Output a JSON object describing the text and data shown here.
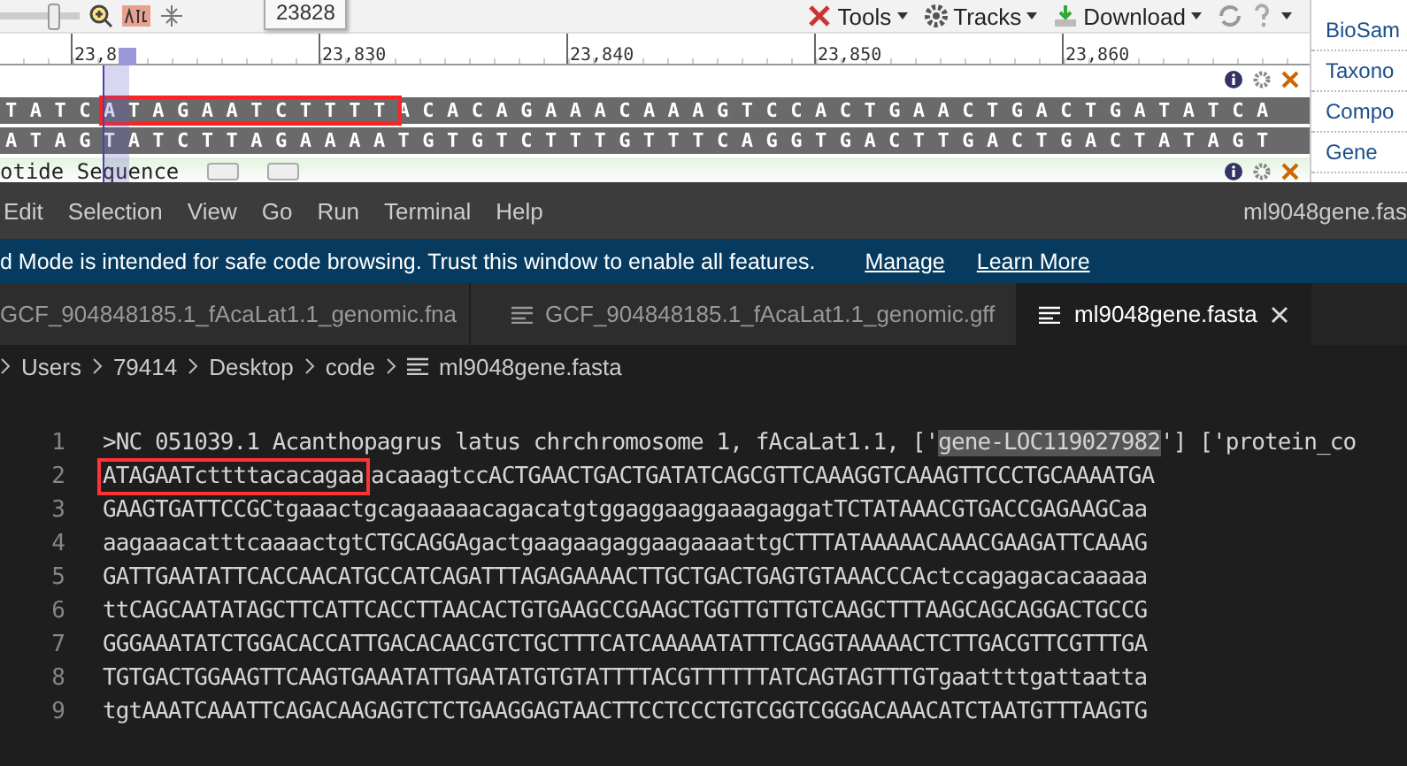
{
  "genome_browser": {
    "toolbar": {
      "tooltip": "23828",
      "zoom_slider": {
        "level": 0.7
      },
      "menus": [
        {
          "label": "Tools"
        },
        {
          "label": "Tracks"
        },
        {
          "label": "Download"
        }
      ]
    },
    "ruler": {
      "labels": [
        "23,8",
        "23,830",
        "23,840",
        "23,850",
        "23,860"
      ]
    },
    "forward_strand": [
      {
        "text": "TATC",
        "kind": "plain"
      },
      {
        "text": "ATAGAATCTTTT",
        "kind": "boxed"
      },
      {
        "text": "ACACAGAAACAAAGTCCACTGAACTGACTGATATCA",
        "kind": "plain"
      }
    ],
    "reverse_strand": "ATAGTATCTTAGAAAATGTGTCTTTGTTTCAGGTGACTTGACTGACTATAGT",
    "track_label": "otide Sequence"
  },
  "sidebar": {
    "items": [
      "BioSam",
      "Taxono",
      "Compo",
      "Gene"
    ]
  },
  "editor": {
    "menu": [
      "Edit",
      "Selection",
      "View",
      "Go",
      "Run",
      "Terminal",
      "Help"
    ],
    "window_title": "ml9048gene.fas",
    "banner": {
      "text": "d Mode is intended for safe code browsing. Trust this window to enable all features.",
      "links": [
        "Manage",
        "Learn More"
      ]
    },
    "tabs": [
      {
        "label": "GCF_904848185.1_fAcaLat1.1_genomic.fna",
        "selected": false,
        "icon": false
      },
      {
        "label": "GCF_904848185.1_fAcaLat1.1_genomic.gff",
        "selected": false,
        "icon": true
      },
      {
        "label": "ml9048gene.fasta",
        "selected": true,
        "icon": true
      }
    ],
    "breadcrumbs": [
      "Users",
      "79414",
      "Desktop",
      "code",
      "ml9048gene.fasta"
    ],
    "lines": [
      {
        "number": "1",
        "segments": [
          {
            "text": ">NC 051039.1 Acanthopagrus latus chrchromosome 1, fAcaLat1.1, ['",
            "kind": "plain"
          },
          {
            "text": "gene-LOC119027982",
            "kind": "selected"
          },
          {
            "text": "'] ['protein_co",
            "kind": "plain"
          }
        ]
      },
      {
        "number": "2",
        "segments": [
          {
            "text": "ATAGAATcttttacacagaa",
            "kind": "boxed"
          },
          {
            "text": "acaaagtccACTGAACTGACTGATATCAGCGTTCAAAGGTCAAAGTTCCCTGCAAAATGA",
            "kind": "plain"
          }
        ]
      },
      {
        "number": "3",
        "segments": [
          {
            "text": "GAAGTGATTCCGCtgaaactgcagaaaaacagacatgtggaggaaggaaagaggatTCTATAAACGTGACCGAGAAGCaa",
            "kind": "plain"
          }
        ]
      },
      {
        "number": "4",
        "segments": [
          {
            "text": "aagaaacatttcaaaactgtCTGCAGGAgactgaagaagaggaagaaaattgCTTTATAAAAACAAACGAAGATTCAAAG",
            "kind": "plain"
          }
        ]
      },
      {
        "number": "5",
        "segments": [
          {
            "text": "GATTGAATATTCACCAACATGCCATCAGATTTAGAGAAAACTTGCTGACTGAGTGTAAACCCActccagagacacaaaaa",
            "kind": "plain"
          }
        ]
      },
      {
        "number": "6",
        "segments": [
          {
            "text": "ttCAGCAATATAGCTTCATTCACCTTAACACTGTGAAGCCGAAGCTGGTTGTTGTCAAGCTTTAAGCAGCAGGACTGCCG",
            "kind": "plain"
          }
        ]
      },
      {
        "number": "7",
        "segments": [
          {
            "text": "GGGAAATATCTGGACACCATTGACACAACGTCTGCTTTCATCAAAAATATTTCAGGTAAAAACTCTTGACGTTCGTTTGA",
            "kind": "plain"
          }
        ]
      },
      {
        "number": "8",
        "segments": [
          {
            "text": "TGTGACTGGAAGTTCAAGTGAAATATTGAATATGTGTATTTTACGTTTTTTATCAGTAGTTTGTgaattttgattaatta",
            "kind": "plain"
          }
        ]
      },
      {
        "number": "9",
        "segments": [
          {
            "text": "tgtAAATCAAATTCAGACAAGAGTCTCTGAAGGAGTAACTTCCTCCCTGTCGGTCGGGACAAACATCTAATGTTTAAGTG",
            "kind": "plain"
          }
        ]
      }
    ]
  }
}
